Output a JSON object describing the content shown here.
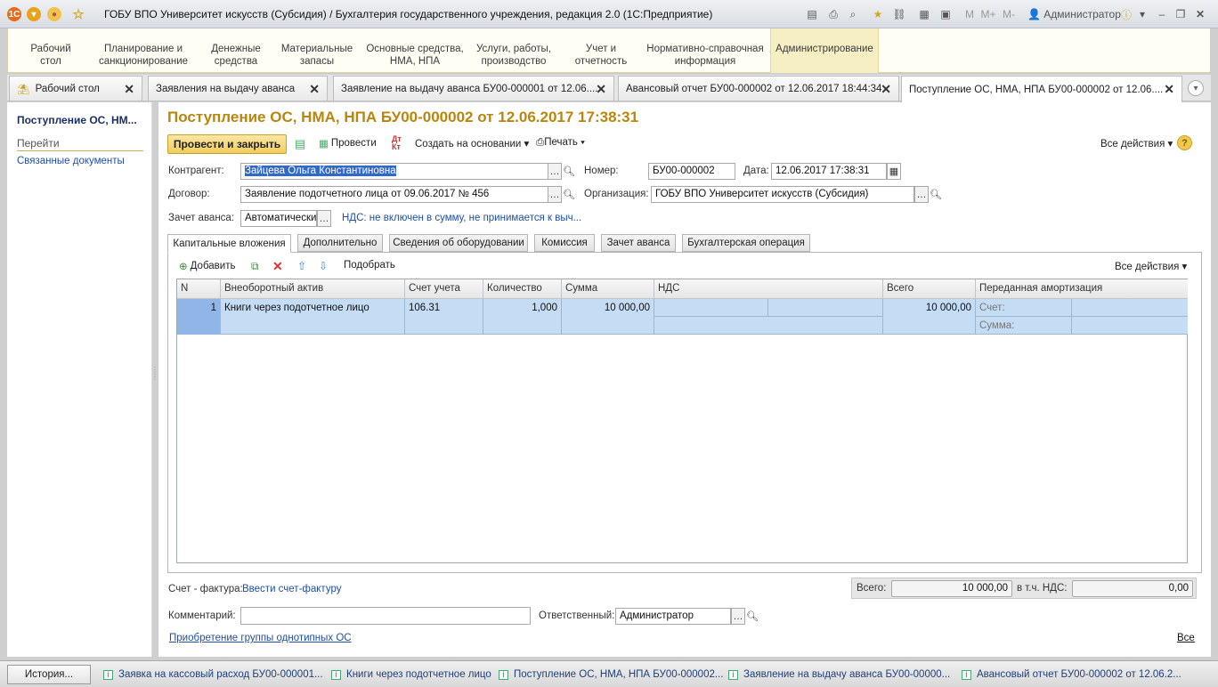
{
  "window": {
    "title": "ГОБУ ВПО Университет искусств (Субсидия) / Бухгалтерия государственного учреждения, редакция 2.0  (1С:Предприятие)",
    "memory_buttons": [
      "M",
      "M+",
      "M-"
    ],
    "user": "Администратор"
  },
  "sections": [
    "Рабочий\nстол",
    "Планирование и\nсанкционирование",
    "Денежные\nсредства",
    "Материальные\nзапасы",
    "Основные средства,\nНМА, НПА",
    "Услуги, работы,\nпроизводство",
    "Учет и\nотчетность",
    "Нормативно-справочная\nинформация",
    "Администрирование"
  ],
  "tabs": [
    "Рабочий стол",
    "Заявления на выдачу аванса",
    "Заявление на выдачу аванса БУ00-000001 от 12.06....",
    "Авансовый отчет БУ00-000002 от 12.06.2017 18:44:34",
    "Поступление ОС, НМА, НПА БУ00-000002 от 12.06...."
  ],
  "left_panel": {
    "title": "Поступление ОС, НМ...",
    "goto_label": "Перейти",
    "items": [
      "Связанные документы"
    ]
  },
  "document": {
    "title": "Поступление ОС, НМА, НПА БУ00-000002 от 12.06.2017 17:38:31",
    "toolbar": {
      "post_close": "Провести и закрыть",
      "post": "Провести",
      "create_based": "Создать на основании",
      "print": "Печать",
      "all_actions": "Все действия"
    },
    "fields": {
      "counterparty_label": "Контрагент:",
      "counterparty": "Зайцева Ольга Константиновна",
      "number_label": "Номер:",
      "number": "БУ00-000002",
      "date_label": "Дата:",
      "date": "12.06.2017 17:38:31",
      "contract_label": "Договор:",
      "contract": "Заявление подотчетного лица от 09.06.2017 № 456",
      "org_label": "Организация:",
      "org": "ГОБУ ВПО Университет искусств (Субсидия)",
      "advance_label": "Зачет аванса:",
      "advance": "Автоматически",
      "vat_link": "НДС: не включен в сумму, не принимается к выч..."
    },
    "inner_tabs": [
      "Капитальные вложения",
      "Дополнительно",
      "Сведения об оборудовании",
      "Комиссия",
      "Зачет аванса",
      "Бухгалтерская операция"
    ],
    "table_toolbar": {
      "add": "Добавить",
      "pick": "Подобрать",
      "all_actions": "Все действия"
    },
    "columns": [
      "N",
      "Внеоборотный актив",
      "Счет учета",
      "Количество",
      "Сумма",
      "НДС",
      "Всего",
      "Переданная амортизация"
    ],
    "rows": [
      {
        "n": "1",
        "asset": "Книги через подотчетное лицо",
        "account": "106.31",
        "qty": "1,000",
        "sum": "10 000,00",
        "vat": "",
        "total": "10 000,00",
        "amort_account_label": "Счет:",
        "amort_sum_label": "Сумма:"
      }
    ],
    "invoice_label": "Счет - фактура:",
    "invoice_link": "Ввести счет-фактуру",
    "total_label": "Всего:",
    "total_value": "10 000,00",
    "vat_incl_label": "в т.ч. НДС:",
    "vat_value": "0,00",
    "comment_label": "Комментарий:",
    "comment": "",
    "responsible_label": "Ответственный:",
    "responsible": "Администратор",
    "group_link": "Приобретение группы однотипных ОС",
    "all_link": "Все"
  },
  "bottom_bar": {
    "history": "История...",
    "items": [
      "Заявка на кассовый расход БУ00-000001...",
      "Книги через подотчетное лицо",
      "Поступление ОС, НМА, НПА БУ00-000002...",
      "Заявление на выдачу аванса БУ00-00000...",
      "Авансовый отчет БУ00-000002 от 12.06.2..."
    ]
  },
  "colors": {
    "title_accent": "#b9860b",
    "selected_row": "#c5dcf5",
    "link": "#1f4fa3"
  }
}
